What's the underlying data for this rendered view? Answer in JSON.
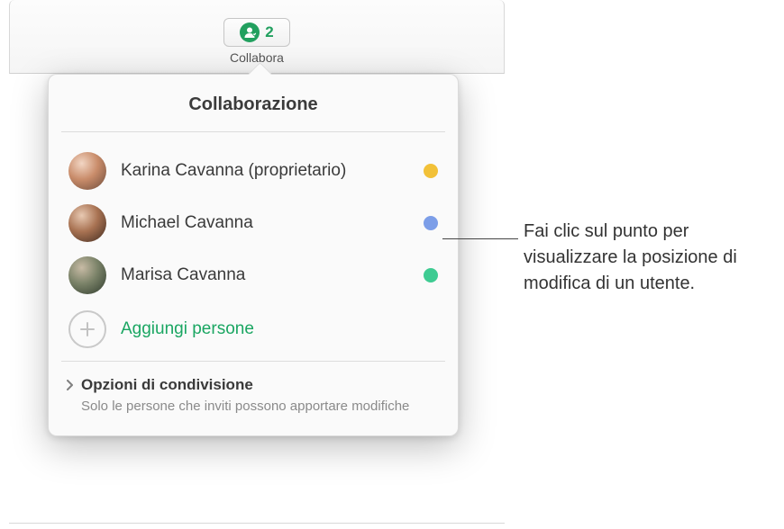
{
  "toolbar": {
    "collab_count": "2",
    "collab_button_label": "Collabora"
  },
  "popover": {
    "title": "Collaborazione",
    "participants": [
      {
        "name": "Karina Cavanna (proprietario)",
        "dot_color": "#f2c138",
        "avatar_bg": "radial-gradient(circle at 35% 30%, #f2d6c4, #c98c6a 45%, #6b4a3a 100%)"
      },
      {
        "name": "Michael Cavanna",
        "dot_color": "#7c9ee8",
        "avatar_bg": "radial-gradient(circle at 35% 30%, #e8c9b2, #a87252 45%, #3e2a1f 100%)"
      },
      {
        "name": "Marisa Cavanna",
        "dot_color": "#3ecb92",
        "avatar_bg": "radial-gradient(circle at 35% 30%, #c8bba5, #7a8268 45%, #2e3a2c 100%)"
      }
    ],
    "add_label": "Aggiungi persone",
    "share": {
      "title": "Opzioni di condivisione",
      "subtitle": "Solo le persone che inviti possono apportare modifiche"
    }
  },
  "callout": {
    "text": "Fai clic sul punto per visualizzare la posizione di modifica di un utente."
  },
  "colors": {
    "accent_green": "#22a05f"
  }
}
